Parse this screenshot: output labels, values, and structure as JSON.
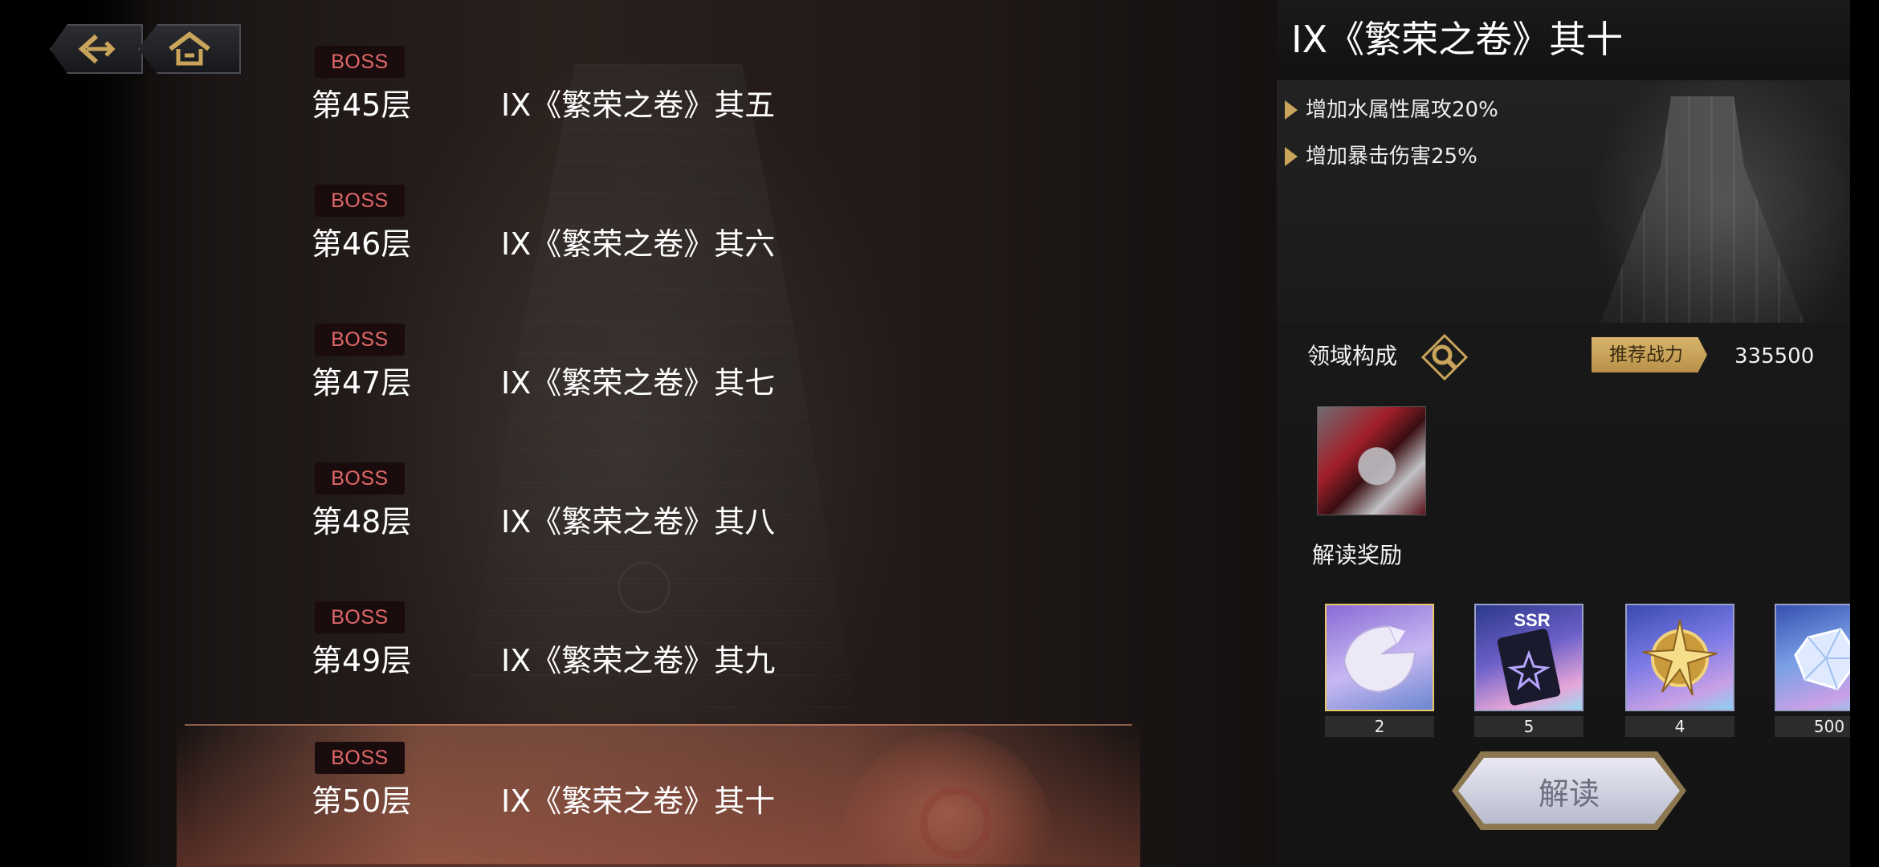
{
  "nav": {
    "back_icon": "back-arrow-icon",
    "home_icon": "home-icon"
  },
  "floors": [
    {
      "boss": "BOSS",
      "floor": "第45层",
      "name": "IX《繁荣之卷》其五"
    },
    {
      "boss": "BOSS",
      "floor": "第46层",
      "name": "IX《繁荣之卷》其六"
    },
    {
      "boss": "BOSS",
      "floor": "第47层",
      "name": "IX《繁荣之卷》其七"
    },
    {
      "boss": "BOSS",
      "floor": "第48层",
      "name": "IX《繁荣之卷》其八"
    },
    {
      "boss": "BOSS",
      "floor": "第49层",
      "name": "IX《繁荣之卷》其九"
    },
    {
      "boss": "BOSS",
      "floor": "第50层",
      "name": "IX《繁荣之卷》其十"
    }
  ],
  "selected_floor_index": 5,
  "panel": {
    "title": "IX《繁荣之卷》其十",
    "buffs": [
      "增加水属性属攻20%",
      "增加暴击伤害25%"
    ],
    "domain_label": "领域构成",
    "power_label": "推荐战力",
    "power_value": "335500",
    "reward_label": "解读奖励",
    "rewards": [
      {
        "icon": "fan-shard-icon",
        "qty": "2"
      },
      {
        "icon": "ssr-card-icon",
        "qty": "5",
        "badge": "SSR"
      },
      {
        "icon": "gold-star-emblem-icon",
        "qty": "4"
      },
      {
        "icon": "crystal-gem-icon",
        "qty": "500"
      }
    ],
    "decode_button": "解读"
  },
  "colors": {
    "accent_gold": "#c9a45b",
    "boss_red": "#e0686a",
    "panel_bg": "#141414"
  }
}
